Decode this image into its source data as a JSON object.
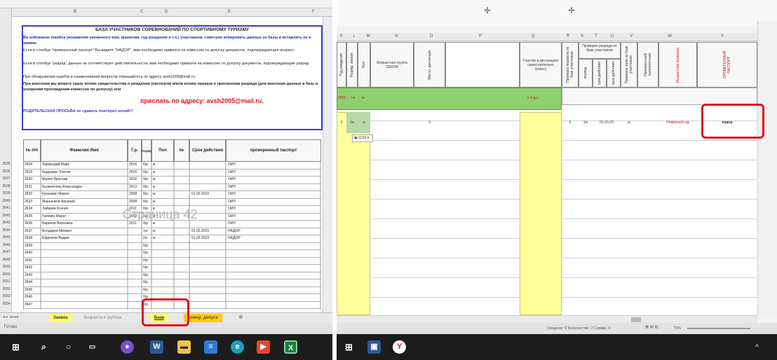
{
  "left": {
    "title": "БАЗА УЧАСТНИКОВ СОРЕВНОВАНИЙ ПО СПОРТИВНОМУ ТУРИЗМУ",
    "instructions": [
      "Во избежание ошибок (искажения указанного имя, фамилия, год рождения и т.п.) участников, советуем копировать данные из базы и вставлять их в заявки.",
      "Если в столбце \"проверенный паспорт\" Вы видите \"НАДОР\", вам необходимо привезти на комиссию по допуску документы, подтверждающие возраст",
      "Если в столбце \"разряд\" данные не соответствуют действительности, вам необходимо привезти на комиссию по допуску документы, подтверждающие разряд",
      "При обнаружении ошибок в наименовании вопросов обращайтесь по адресу avsh2005@mail.ru",
      "При внесении вы можете сразу копию свидетельства о рождении (паспорта) и/или копию приказа о присвоении разряда (для внесения данных в базу и ускорения прохождения комиссии по допуску) или"
    ],
    "send_text": "прислать по адресу: avsh2005@mail.ru.",
    "parent_note": "РОДИТЕЛЬСКАЯ ПРОСЬБА не сдавать повторно копий!!!",
    "headers": [
      "№ п/п",
      "Фамилия Имя",
      "Г.р.",
      "Разряд",
      "Пол",
      "№",
      "Срок действия",
      "проверенный паспорт"
    ],
    "rows": [
      {
        "rn": "2635",
        "n": "2628",
        "name": "Заржецкий Марк",
        "yr": "2016",
        "r": "б/р",
        "sex": "м",
        "date": "",
        "pass": "ОЙЛ"
      },
      {
        "rn": "2636",
        "n": "2629",
        "name": "Кадушкин Злотан",
        "yr": "2016",
        "r": "б/р",
        "sex": "м",
        "date": "",
        "pass": "ОЙЛ"
      },
      {
        "rn": "2637",
        "n": "2630",
        "name": "Бирюк Ярослав",
        "yr": "2016",
        "r": "б/р",
        "sex": "м",
        "date": "",
        "pass": "ОЙЛ"
      },
      {
        "rn": "2638",
        "n": "2631",
        "name": "Калиничева Александра",
        "yr": "2013",
        "r": "б/р",
        "sex": "ж",
        "date": "",
        "pass": "ОЙЛ"
      },
      {
        "rn": "2639",
        "n": "2632",
        "name": "Кукушкин Мирон",
        "yr": "2008",
        "r": "б/р",
        "sex": "м",
        "date": "01.03.2023",
        "pass": "ОЙЛ"
      },
      {
        "rn": "2640",
        "n": "2633",
        "name": "Марьенков Арсений",
        "yr": "2008",
        "r": "б/р",
        "sex": "м",
        "date": "",
        "pass": "ОЙЛ"
      },
      {
        "rn": "2641",
        "n": "2634",
        "name": "Зайцева Ксения",
        "yr": "2011",
        "r": "б/р",
        "sex": "ж",
        "date": "",
        "pass": "ОЙЛ"
      },
      {
        "rn": "2642",
        "n": "2635",
        "name": "Гречкин Марат",
        "yr": "2009",
        "r": "б/р",
        "sex": "м",
        "date": "",
        "pass": "ОЙЛ"
      },
      {
        "rn": "2643",
        "n": "2636",
        "name": "Баринов Вероника",
        "yr": "2011",
        "r": "б/р",
        "sex": "ж",
        "date": "",
        "pass": "ОЙЛ"
      },
      {
        "rn": "2644",
        "n": "2637",
        "name": "Бондарев Михаил",
        "yr": "",
        "r": "1ю",
        "sex": "м",
        "date": "01.03.2023",
        "pass": "НАДОР"
      },
      {
        "rn": "2645",
        "n": "2638",
        "name": "Ефремов Вадим",
        "yr": "",
        "r": "2ю",
        "sex": "м",
        "date": "01.03.2023",
        "pass": "НАДОР"
      },
      {
        "rn": "2646",
        "n": "2639",
        "name": "",
        "yr": "",
        "r": "б/р",
        "sex": "",
        "date": "",
        "pass": ""
      },
      {
        "rn": "2647",
        "n": "2640",
        "name": "",
        "yr": "",
        "r": "б/р",
        "sex": "",
        "date": "",
        "pass": ""
      },
      {
        "rn": "2648",
        "n": "2641",
        "name": "",
        "yr": "",
        "r": "б/р",
        "sex": "",
        "date": "",
        "pass": ""
      },
      {
        "rn": "2649",
        "n": "2642",
        "name": "",
        "yr": "",
        "r": "б/р",
        "sex": "",
        "date": "",
        "pass": ""
      },
      {
        "rn": "2650",
        "n": "2643",
        "name": "",
        "yr": "",
        "r": "б/р",
        "sex": "",
        "date": "",
        "pass": ""
      },
      {
        "rn": "2651",
        "n": "2644",
        "name": "",
        "yr": "",
        "r": "б/р",
        "sex": "",
        "date": "",
        "pass": ""
      },
      {
        "rn": "2652",
        "n": "2645",
        "name": "",
        "yr": "",
        "r": "б/р",
        "sex": "",
        "date": "",
        "pass": ""
      },
      {
        "rn": "2653",
        "n": "2646",
        "name": "",
        "yr": "",
        "r": "б/р",
        "sex": "",
        "date": "",
        "pass": ""
      },
      {
        "rn": "2654",
        "n": "2647",
        "name": "",
        "yr": "",
        "r": "б/р",
        "sex": "",
        "date": "",
        "pass": ""
      }
    ],
    "watermark": "Страница 42",
    "tabs": [
      "Заявка",
      "Возраста в группах",
      "База",
      "номер_допуск"
    ],
    "status": "Готово"
  },
  "right": {
    "headers": {
      "h_birth": "Год рождения",
      "h_rank": "Разряд, звание",
      "h_sex": "Пол",
      "h_group": "Возрастная группа СЕКОМ",
      "h_place": "Место, дистанция",
      "h_class": "Участие в дистанциях самостоятельно (класс)",
      "h_check_age": "Проверка возраста по базе участников",
      "h_check_rank": "Проверка разряда по базе участников",
      "h_period": "период",
      "h_expiry": "срок действия",
      "h_check_sex": "Проверка пола по базе участников",
      "h_verified": "Проверенный/выполненный",
      "h_age_check": "Возрастная проверка",
      "h_passport": "ПРОВЕРЕННЫЙ ПАСПОРТ"
    },
    "green_row": {
      "group": "2009",
      "rank": "1ю",
      "sex": "м",
      "place": "н 2 д-з"
    },
    "data_row": {
      "yr": "2",
      "rank": "1ю",
      "sex": "м",
      "place": "3",
      "num": "6",
      "rank2": "1ю",
      "date": "01.03.23",
      "sex2": "м",
      "age_note": "Неверный год",
      "passport": "надор"
    },
    "paste_label": "(Ctrl) ▾",
    "status": "Среднее: 0   Количество: 2   Сумма: 0",
    "zoom": "70%"
  },
  "taskbar": {
    "icons": [
      "windows-start-icon",
      "search-icon",
      "cortana-icon",
      "task-view-icon",
      "viber-icon",
      "word-icon",
      "file-explorer-icon",
      "notepad-icon",
      "edge-icon",
      "foxit-icon",
      "excel-icon",
      "windows-start-icon",
      "store-icon",
      "yandex-icon"
    ]
  }
}
